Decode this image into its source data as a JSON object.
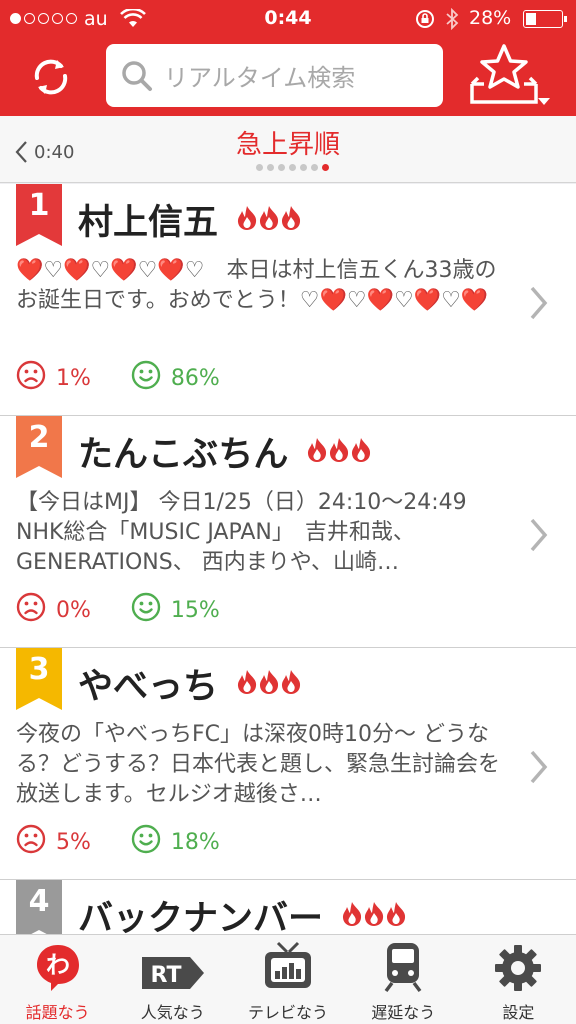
{
  "status_bar": {
    "carrier": "au",
    "time": "0:44",
    "battery_percent_text": "28%",
    "battery_level": 0.28
  },
  "search": {
    "placeholder": "リアルタイム検索"
  },
  "sub_header": {
    "back_label": "0:40",
    "title": "急上昇順",
    "page_count": 7,
    "active_page": 7
  },
  "items": [
    {
      "rank": "1",
      "rank_color": "#e3393a",
      "title": "村上信五",
      "heat_icons": 3,
      "text": "❤️♡❤️♡❤️♡❤️♡　本日は村上信五くん33歳のお誕生日です。おめでとう！♡❤️♡❤️♡❤️♡❤️",
      "negative": "1%",
      "positive": "86%"
    },
    {
      "rank": "2",
      "rank_color": "#f1774a",
      "title": "たんこぶちん",
      "heat_icons": 3,
      "text": "【今日はMJ】 今日1/25（日）24:10〜24:49 NHK総合「MUSIC JAPAN」　吉井和哉、GENERATIONS、 西内まりや、山崎…",
      "negative": "0%",
      "positive": "15%"
    },
    {
      "rank": "3",
      "rank_color": "#f5b800",
      "title": "やべっち",
      "heat_icons": 3,
      "text": "今夜の「やべっちFC」は深夜0時10分〜 どうなる？どうする？日本代表と題し、緊急生討論会を放送します。セルジオ越後さ…",
      "negative": "5%",
      "positive": "18%"
    },
    {
      "rank": "4",
      "rank_color": "#9a9a9a",
      "title": "バックナンバー",
      "heat_icons": 3,
      "text": "",
      "negative": "",
      "positive": ""
    }
  ],
  "tabs": [
    {
      "label": "話題なう",
      "icon": "wadai-icon",
      "active": true
    },
    {
      "label": "人気なう",
      "icon": "rt-icon",
      "active": false
    },
    {
      "label": "テレビなう",
      "icon": "tv-icon",
      "active": false
    },
    {
      "label": "遅延なう",
      "icon": "train-icon",
      "active": false
    },
    {
      "label": "設定",
      "icon": "gear-icon",
      "active": false
    }
  ],
  "colors": {
    "brand_red": "#e32b2c",
    "negative": "#d9383a",
    "positive": "#4fae4f"
  }
}
